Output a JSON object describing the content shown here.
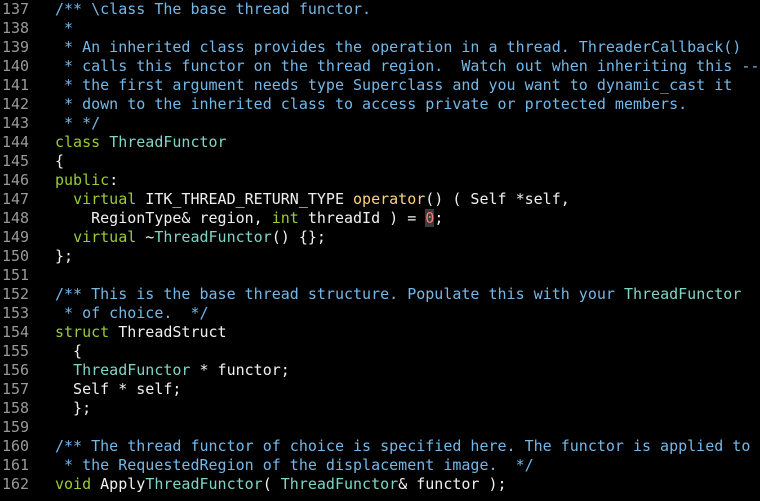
{
  "editor": {
    "colors": {
      "background": "#000000",
      "line_number": "#9a9a9a",
      "comment": "#73b8e8",
      "keyword": "#9acd32",
      "type": "#7fd6c6",
      "function": "#ffd27a",
      "normal": "#f0f0f0",
      "number": "#ff7a7a"
    },
    "lines": [
      {
        "n": "137",
        "tokens": [
          {
            "c": "comment",
            "t": "/** \\class The base thread functor."
          }
        ]
      },
      {
        "n": "138",
        "tokens": [
          {
            "c": "comment",
            "t": " *"
          }
        ]
      },
      {
        "n": "139",
        "tokens": [
          {
            "c": "comment",
            "t": " * An inherited class provides the operation in a thread. ThreaderCallback()"
          }
        ]
      },
      {
        "n": "140",
        "tokens": [
          {
            "c": "comment",
            "t": " * calls this functor on the thread region.  Watch out when inheriting this --"
          }
        ]
      },
      {
        "n": "141",
        "tokens": [
          {
            "c": "comment",
            "t": " * the first argument needs type Superclass and you want to dynamic_cast it"
          }
        ]
      },
      {
        "n": "142",
        "tokens": [
          {
            "c": "comment",
            "t": " * down to the inherited class to access private or protected members."
          }
        ]
      },
      {
        "n": "143",
        "tokens": [
          {
            "c": "comment",
            "t": " * */"
          }
        ]
      },
      {
        "n": "144",
        "tokens": [
          {
            "c": "keyword",
            "t": "class "
          },
          {
            "c": "type",
            "t": "ThreadFunctor"
          }
        ]
      },
      {
        "n": "145",
        "tokens": [
          {
            "c": "normal",
            "t": "{"
          }
        ]
      },
      {
        "n": "146",
        "tokens": [
          {
            "c": "keyword",
            "t": "public"
          },
          {
            "c": "normal",
            "t": ":"
          }
        ]
      },
      {
        "n": "147",
        "tokens": [
          {
            "c": "normal",
            "t": "  "
          },
          {
            "c": "keyword",
            "t": "virtual"
          },
          {
            "c": "normal",
            "t": " ITK_THREAD_RETURN_TYPE "
          },
          {
            "c": "function",
            "t": "operator"
          },
          {
            "c": "normal",
            "t": "() ( Self *self,"
          }
        ]
      },
      {
        "n": "148",
        "tokens": [
          {
            "c": "normal",
            "t": "    RegionType& region, "
          },
          {
            "c": "keyword",
            "t": "int"
          },
          {
            "c": "normal",
            "t": " threadId ) = "
          },
          {
            "c": "number",
            "t": "0"
          },
          {
            "c": "normal",
            "t": ";"
          }
        ]
      },
      {
        "n": "149",
        "tokens": [
          {
            "c": "normal",
            "t": "  "
          },
          {
            "c": "keyword",
            "t": "virtual"
          },
          {
            "c": "normal",
            "t": " ~"
          },
          {
            "c": "type",
            "t": "ThreadFunctor"
          },
          {
            "c": "normal",
            "t": "() {};"
          }
        ]
      },
      {
        "n": "150",
        "tokens": [
          {
            "c": "normal",
            "t": "};"
          }
        ]
      },
      {
        "n": "151",
        "tokens": []
      },
      {
        "n": "152",
        "tokens": [
          {
            "c": "comment",
            "t": "/** This is the base thread structure. Populate this with your "
          },
          {
            "c": "type",
            "t": "ThreadFunctor"
          }
        ]
      },
      {
        "n": "153",
        "tokens": [
          {
            "c": "comment",
            "t": " * of choice.  */"
          }
        ]
      },
      {
        "n": "154",
        "tokens": [
          {
            "c": "keyword",
            "t": "struct"
          },
          {
            "c": "normal",
            "t": " ThreadStruct"
          }
        ]
      },
      {
        "n": "155",
        "tokens": [
          {
            "c": "normal",
            "t": "  {"
          }
        ]
      },
      {
        "n": "156",
        "tokens": [
          {
            "c": "normal",
            "t": "  "
          },
          {
            "c": "type",
            "t": "ThreadFunctor"
          },
          {
            "c": "normal",
            "t": " * functor;"
          }
        ]
      },
      {
        "n": "157",
        "tokens": [
          {
            "c": "normal",
            "t": "  Self * self;"
          }
        ]
      },
      {
        "n": "158",
        "tokens": [
          {
            "c": "normal",
            "t": "  };"
          }
        ]
      },
      {
        "n": "159",
        "tokens": []
      },
      {
        "n": "160",
        "tokens": [
          {
            "c": "comment",
            "t": "/** The thread functor of choice is specified here. The functor is applied to"
          }
        ]
      },
      {
        "n": "161",
        "tokens": [
          {
            "c": "comment",
            "t": " * the RequestedRegion of the displacement image.  */"
          }
        ]
      },
      {
        "n": "162",
        "tokens": [
          {
            "c": "keyword",
            "t": "void"
          },
          {
            "c": "normal",
            "t": " Apply"
          },
          {
            "c": "type",
            "t": "ThreadFunctor"
          },
          {
            "c": "normal",
            "t": "( "
          },
          {
            "c": "type",
            "t": "ThreadFunctor"
          },
          {
            "c": "normal",
            "t": "& functor );"
          }
        ]
      }
    ]
  }
}
